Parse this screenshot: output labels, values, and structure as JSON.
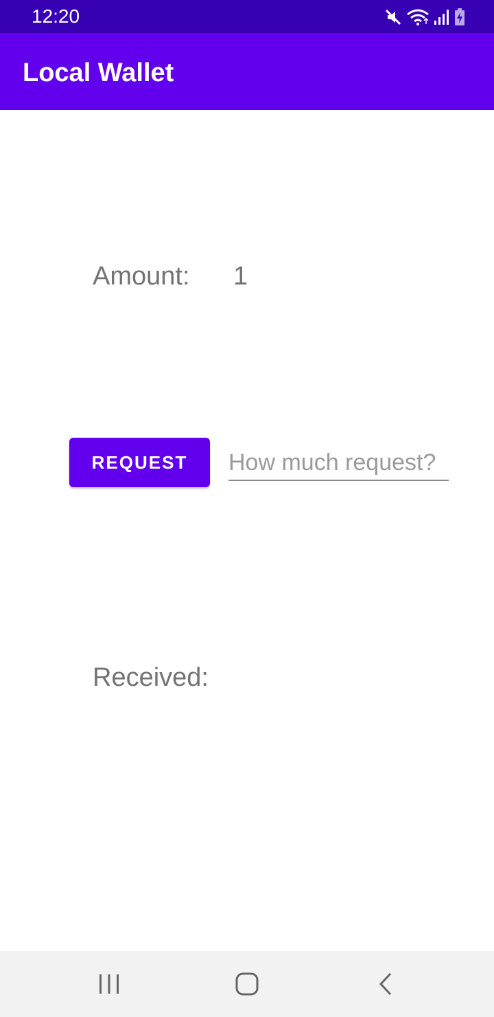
{
  "status_bar": {
    "time": "12:20",
    "icons": [
      "mute-icon",
      "wifi-icon",
      "signal-icon",
      "battery-charging-icon"
    ]
  },
  "app_bar": {
    "title": "Local Wallet"
  },
  "amount": {
    "label": "Amount:",
    "value": "1"
  },
  "request": {
    "button_label": "REQUEST",
    "input_placeholder": "How much request?",
    "input_value": ""
  },
  "received": {
    "label": "Received:"
  },
  "nav_bar": {
    "buttons": [
      "recents-icon",
      "home-icon",
      "back-icon"
    ]
  },
  "colors": {
    "primary": "#6200ee",
    "primary_dark": "#3700b3",
    "label_text": "#737373",
    "nav_background": "#f2f2f2"
  }
}
